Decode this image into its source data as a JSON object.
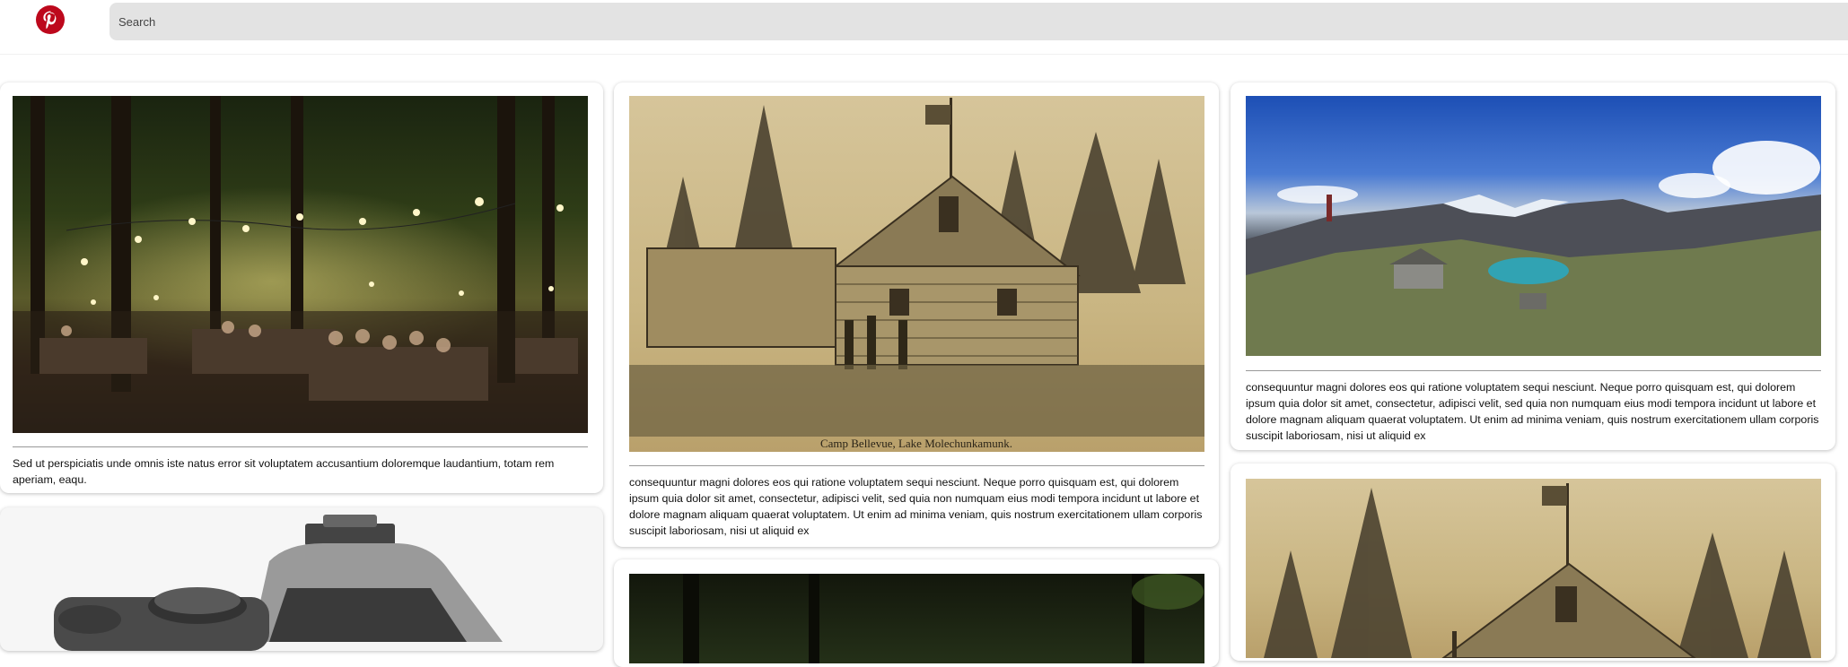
{
  "header": {
    "logo_alt": "Pinterest",
    "search_placeholder": "Search"
  },
  "brand_colors": {
    "pinterest_red": "#bd081c",
    "search_bg": "#e3e3e3"
  },
  "pins": [
    {
      "image": "forest-beer-garden-night-photo",
      "caption": "Sed ut perspiciatis unde omnis iste natus error sit voluptatem accusantium doloremque laudantium, totam rem aperiam, eaqu."
    },
    {
      "image": "camp-bellevue-engraving",
      "image_caption_text": "Camp Bellevue, Lake Molechunkamunk.",
      "caption": "consequuntur magni dolores eos qui ratione voluptatem sequi nesciunt. Neque porro quisquam est, qui dolorem ipsum quia dolor sit amet, consectetur, adipisci velit, sed quia non numquam eius modi tempora incidunt ut labore et dolore magnam aliquam quaerat voluptatem. Ut enim ad minima veniam, quis nostrum exercitationem ullam corporis suscipit laboriosam, nisi ut aliquid ex"
    },
    {
      "image": "alpine-lake-hut-panorama",
      "caption": "consequuntur magni dolores eos qui ratione voluptatem sequi nesciunt. Neque porro quisquam est, qui dolorem ipsum quia dolor sit amet, consectetur, adipisci velit, sed quia non numquam eius modi tempora incidunt ut labore et dolore magnam aliquam quaerat voluptatem. Ut enim ad minima veniam, quis nostrum exercitationem ullam corporis suscipit laboriosam, nisi ut aliquid ex"
    },
    {
      "image": "camera-illustration"
    },
    {
      "image": "forest-night-photo"
    },
    {
      "image": "camp-bellevue-engraving"
    }
  ]
}
